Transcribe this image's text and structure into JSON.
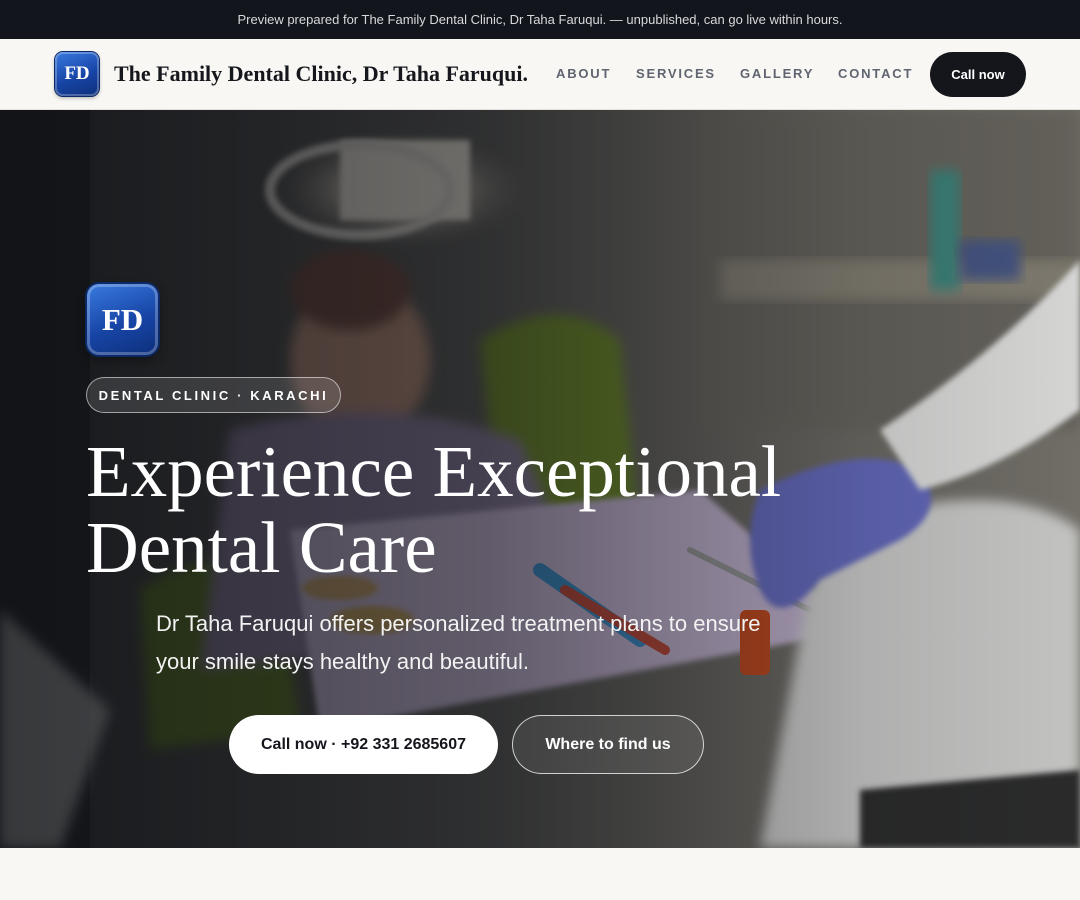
{
  "preview_bar": {
    "text": "Preview prepared for The Family Dental Clinic, Dr Taha Faruqui. — unpublished, can go live within hours."
  },
  "header": {
    "logo_text": "FD",
    "brand_name": "The Family Dental Clinic, Dr Taha Faruqui.",
    "nav": [
      {
        "label": "ABOUT"
      },
      {
        "label": "SERVICES"
      },
      {
        "label": "GALLERY"
      },
      {
        "label": "CONTACT"
      }
    ],
    "cta_label": "Call now"
  },
  "hero": {
    "logo_text": "FD",
    "eyebrow": "DENTAL CLINIC · KARACHI",
    "title": "Experience Exceptional Dental Care",
    "subtitle": "Dr Taha Faruqui offers personalized treatment plans to ensure your smile stays healthy and beautiful.",
    "primary_button": "Call now · +92 331 2685607",
    "secondary_button": "Where to find us",
    "background_image": "dental-treatment-photo"
  },
  "colors": {
    "accent_dark": "#14161c",
    "logo_blue": "#1745a6",
    "page_bg": "#f8f7f3",
    "preview_bar_bg": "#12151b",
    "nav_text": "#5f6470"
  }
}
